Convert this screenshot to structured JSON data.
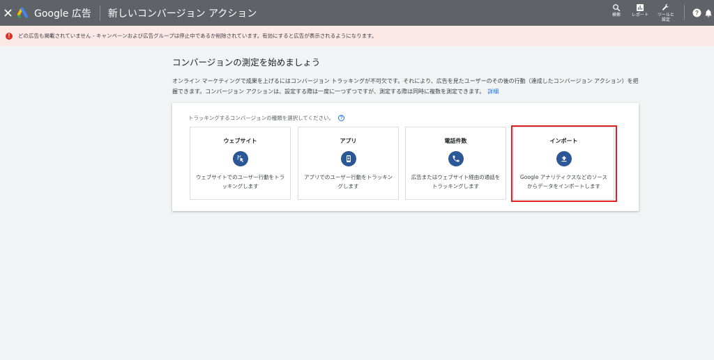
{
  "header": {
    "logo_text": "Google 広告",
    "title": "新しいコンバージョン アクション",
    "actions": [
      {
        "label": "検索",
        "icon": "search-icon"
      },
      {
        "label": "レポート",
        "icon": "reports-icon"
      },
      {
        "label": "ツールと設定",
        "icon": "wrench-icon"
      }
    ]
  },
  "banner": {
    "message": "どの広告も掲載されていません - キャンペーンおよび広告グループは停止中であるか削除されています。有効にすると広告が表示されるようになります。",
    "color": "#d93025"
  },
  "main": {
    "heading": "コンバージョンの測定を始めましょう",
    "description": "オンライン マーケティングで成果を上げるにはコンバージョン トラッキングが不可欠です。それにより、広告を見たユーザーのその後の行動（達成したコンバージョン アクション）を把握できます。コンバージョン アクションは、設定する際は一度に一つずつですが、測定する際は同時に複数を測定できます。",
    "details_link": "詳細"
  },
  "card": {
    "label": "トラッキングするコンバージョンの種類を選択してください。",
    "options": [
      {
        "title": "ウェブサイト",
        "icon": "cursor-click-icon",
        "description": "ウェブサイトでのユーザー行動をトラッキングします"
      },
      {
        "title": "アプリ",
        "icon": "phone-app-icon",
        "description": "アプリでのユーザー行動をトラッキングします"
      },
      {
        "title": "電話件数",
        "icon": "phone-call-icon",
        "description": "広告またはウェブサイト経由の通話をトラッキングします"
      },
      {
        "title": "インポート",
        "icon": "upload-icon",
        "description": "Google アナリティクスなどのソースからデータをインポートします"
      }
    ]
  },
  "colors": {
    "header_bg": "#5f6368",
    "banner_bg": "#fce8e6",
    "icon_circle": "#2b5797",
    "link": "#1a73e8",
    "highlight": "#e02020"
  }
}
